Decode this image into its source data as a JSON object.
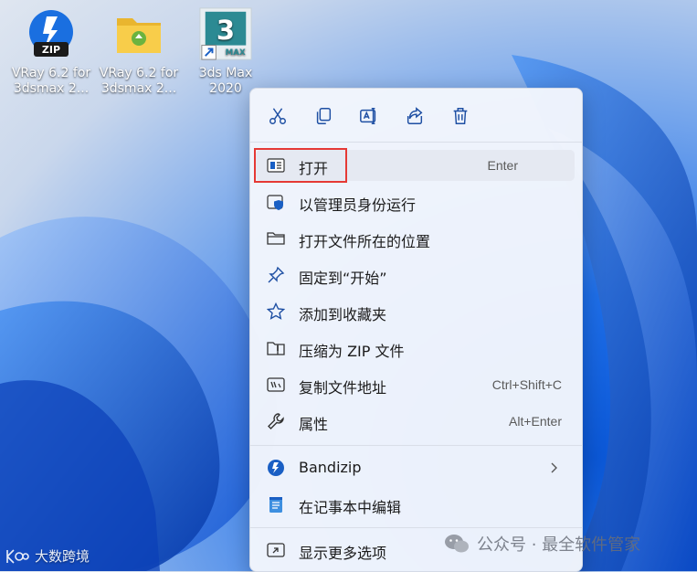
{
  "desktop": {
    "icons": [
      {
        "label_line1": "VRay 6.2 for",
        "label_line2": "3dsmax 2...",
        "icon": "bandizip-zip-icon"
      },
      {
        "label_line1": "VRay 6.2 for",
        "label_line2": "3dsmax 2...",
        "icon": "folder-icon"
      },
      {
        "label_line1": "3ds Max",
        "label_line2": "2020",
        "icon": "3ds-max-icon",
        "badge": "MAX",
        "numeral": "3"
      }
    ],
    "zip_badge": "ZIP"
  },
  "context_menu": {
    "toolbar": [
      {
        "name": "cut",
        "icon": "scissors-icon"
      },
      {
        "name": "copy",
        "icon": "copy-icon"
      },
      {
        "name": "rename",
        "icon": "rename-icon"
      },
      {
        "name": "share",
        "icon": "share-icon"
      },
      {
        "name": "delete",
        "icon": "trash-icon"
      }
    ],
    "items": [
      {
        "label": "打开",
        "shortcut": "Enter",
        "icon": "open-window-icon"
      },
      {
        "label": "以管理员身份运行",
        "shortcut": "",
        "icon": "shield-icon"
      },
      {
        "label": "打开文件所在的位置",
        "shortcut": "",
        "icon": "folder-icon"
      },
      {
        "label": "固定到“开始”",
        "shortcut": "",
        "icon": "pin-icon"
      },
      {
        "label": "添加到收藏夹",
        "shortcut": "",
        "icon": "star-icon"
      },
      {
        "label": "压缩为 ZIP 文件",
        "shortcut": "",
        "icon": "zip-folder-icon"
      },
      {
        "label": "复制文件地址",
        "shortcut": "Ctrl+Shift+C",
        "icon": "copy-path-icon"
      },
      {
        "label": "属性",
        "shortcut": "Alt+Enter",
        "icon": "wrench-icon"
      },
      {
        "label": "Bandizip",
        "shortcut": "",
        "icon": "bandizip-icon"
      },
      {
        "label": "在记事本中编辑",
        "shortcut": "",
        "icon": "notepad-icon"
      },
      {
        "label": "显示更多选项",
        "shortcut": "",
        "icon": "more-options-icon"
      }
    ]
  },
  "watermarks": {
    "left": "大数跨境",
    "right": "公众号 · 最全软件管家"
  },
  "colors": {
    "highlight": "#e53935",
    "menu_bg": "#f3f6fc",
    "hover_bg": "#e5e9f2"
  }
}
